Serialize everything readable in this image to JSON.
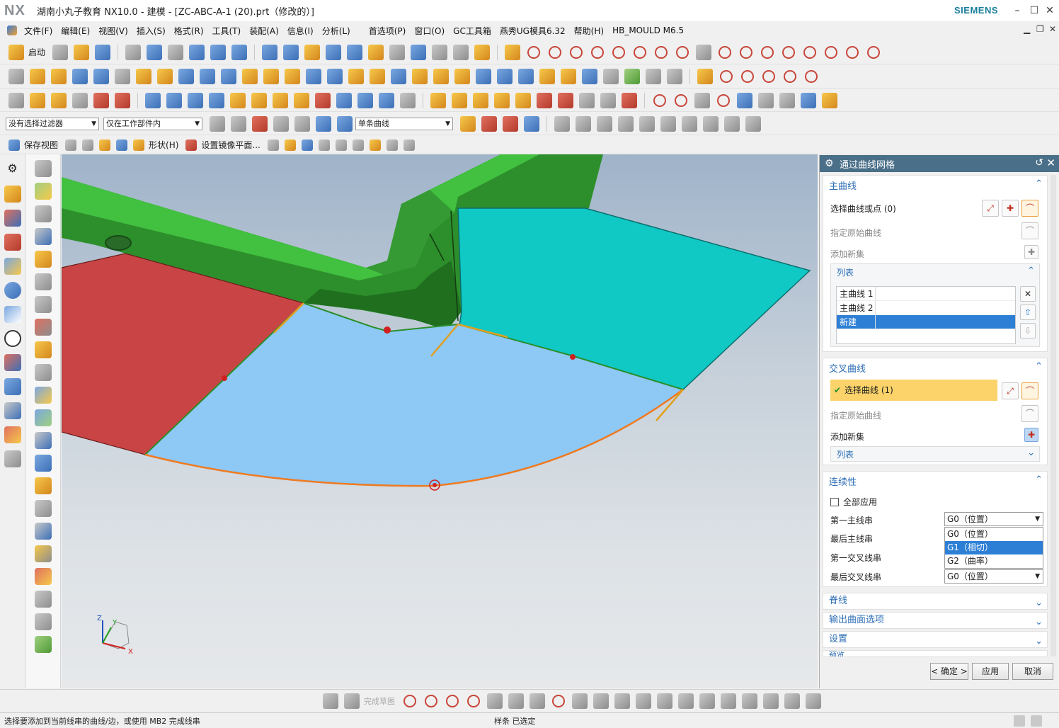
{
  "app": {
    "logo": "NX",
    "title": "湖南小丸子教育 NX10.0 - 建模 - [ZC-ABC-A-1 (20).prt（修改的）]",
    "brand": "SIEMENS",
    "window_buttons": [
      "–",
      "☐",
      "✕"
    ]
  },
  "menu": {
    "items": [
      "文件(F)",
      "编辑(E)",
      "视图(V)",
      "插入(S)",
      "格式(R)",
      "工具(T)",
      "装配(A)",
      "信息(I)",
      "分析(L)",
      "首选项(P)",
      "窗口(O)",
      "GC工具箱",
      "燕秀UG模具6.32",
      "帮助(H)",
      "HB_MOULD M6.5"
    ]
  },
  "toolbar1": {
    "start_label": "启动"
  },
  "selection_bar": {
    "filter": "没有选择过滤器",
    "scope": "仅在工作部件内",
    "curve_rule": "单条曲线"
  },
  "view_bar": {
    "save_view": "保存视图",
    "shape": "形状(H)",
    "mirror_plane": "设置镜像平面..."
  },
  "viewport": {
    "axis_labels": {
      "x": "X",
      "y": "Y",
      "z": "Z"
    }
  },
  "dialog": {
    "title": "通过曲线网格",
    "primary": {
      "header": "主曲线",
      "select_label": "选择曲线或点 (0)",
      "specify_origin": "指定原始曲线",
      "add_new_set": "添加新集",
      "list_header": "列表",
      "list_items": [
        "主曲线 1",
        "主曲线 2",
        "新建"
      ]
    },
    "cross": {
      "header": "交叉曲线",
      "select_label": "选择曲线 (1)",
      "specify_origin": "指定原始曲线",
      "add_new_set": "添加新集",
      "list_header": "列表"
    },
    "continuity": {
      "header": "连续性",
      "apply_all": "全部应用",
      "first_primary": "第一主线串",
      "last_primary": "最后主线串",
      "first_cross": "第一交叉线串",
      "last_cross": "最后交叉线串",
      "first_primary_value": "G0（位置）",
      "last_cross_value": "G0（位置）",
      "dropdown_options": [
        "G0（位置）",
        "G1（相切）",
        "G2（曲率）"
      ],
      "dropdown_highlight": "G1（相切）"
    },
    "collapsed": {
      "spine": "脊线",
      "output": "输出曲面选项",
      "settings": "设置",
      "preview": "预览"
    },
    "buttons": {
      "ok": "< 确定 >",
      "apply": "应用",
      "cancel": "取消"
    }
  },
  "bottom_toolbar": {
    "finish_sketch": "完成草图"
  },
  "status": {
    "prompt": "选择要添加到当前线串的曲线/边，或使用 MB2 完成线串",
    "selection": "样条 已选定"
  },
  "colors": {
    "dialog_title_bg": "#4a6f88",
    "section_header": "#2e6fb6",
    "selection_highlight": "#2d7fd6",
    "active_row": "#fbd36a",
    "surface_blue": "#8ec8f5",
    "cyan_face": "#10c8c4",
    "red_face": "#c94545",
    "green_part": "#3cb83a",
    "curve_orange": "#f07a20"
  }
}
